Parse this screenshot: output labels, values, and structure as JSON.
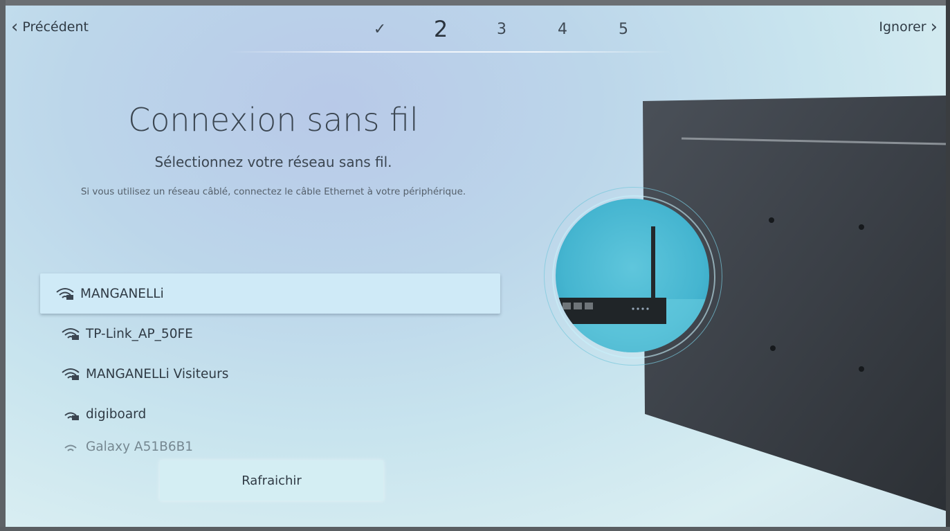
{
  "header": {
    "back_label": "Précédent",
    "skip_label": "Ignorer",
    "steps": [
      {
        "label": "✓",
        "state": "done"
      },
      {
        "label": "2",
        "state": "active"
      },
      {
        "label": "3",
        "state": "pending"
      },
      {
        "label": "4",
        "state": "pending"
      },
      {
        "label": "5",
        "state": "pending"
      }
    ]
  },
  "main": {
    "title": "Connexion sans fil",
    "subtitle": "Sélectionnez votre réseau sans fil.",
    "note": "Si vous utilisez un réseau câblé, connectez le câble Ethernet à votre périphérique."
  },
  "networks": [
    {
      "name": "MANGANELLi",
      "selected": true,
      "icon": "wifi-secured-icon"
    },
    {
      "name": "TP-Link_AP_50FE",
      "selected": false,
      "icon": "wifi-secured-icon"
    },
    {
      "name": "MANGANELLi Visiteurs",
      "selected": false,
      "icon": "wifi-secured-icon"
    },
    {
      "name": "digiboard",
      "selected": false,
      "icon": "wifi-secured-icon"
    },
    {
      "name": "Galaxy A51B6B1",
      "selected": false,
      "icon": "wifi-secured-icon"
    }
  ],
  "actions": {
    "refresh_label": "Rafraichir"
  }
}
